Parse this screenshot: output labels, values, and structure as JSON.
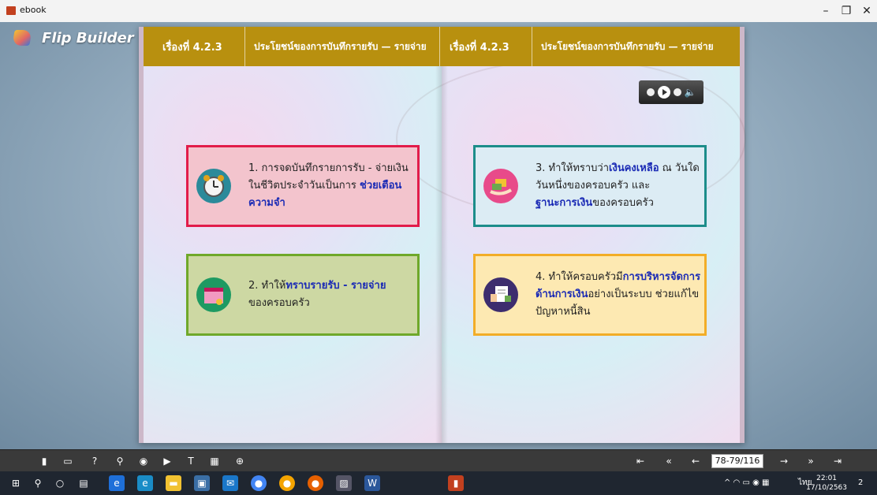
{
  "window": {
    "title": "ebook",
    "minimize": "–",
    "maximize": "❐",
    "close": "✕"
  },
  "brand": {
    "name": "Flip Builder"
  },
  "header": {
    "left_num": "เรื่องที่ 4.2.3",
    "left_title": "ประโยชน์ของการบันทึกรายรับ — รายจ่าย",
    "right_num": "เรื่องที่ 4.2.3",
    "right_title": "ประโยชน์ของการบันทึกรายรับ — รายจ่าย"
  },
  "cards": {
    "c1": {
      "pre": "1. การจดบันทึกรายการรับ - จ่ายเงินในชีวิตประจำวันเป็นการ",
      "hl": "ช่วยเตือนความจำ",
      "post": ""
    },
    "c2": {
      "pre": "2. ทำให้",
      "hl": "ทราบรายรับ - รายจ่าย",
      "post": "ของครอบครัว"
    },
    "c3": {
      "pre": "3. ทำให้ทราบว่า",
      "hl": "เงินคงเหลือ",
      "mid": " ณ วันใดวันหนึ่งของครอบครัว และ",
      "hl2": "ฐานะการเงิน",
      "post": "ของครอบครัว"
    },
    "c4": {
      "pre": "4. ทำให้ครอบครัวมี",
      "hl": "การบริหารจัดการด้านการเงิน",
      "post": "อย่างเป็นระบบ ช่วยแก้ไขปัญหาหนี้สิน"
    }
  },
  "toolbar": {
    "page_indicator": "78-79/116"
  },
  "taskbar": {
    "lang": "ไทย",
    "time": "22:01",
    "date": "17/10/2563",
    "notif": "2"
  },
  "colors": {
    "header": "#b8900f",
    "highlight": "#1b2bb5"
  }
}
